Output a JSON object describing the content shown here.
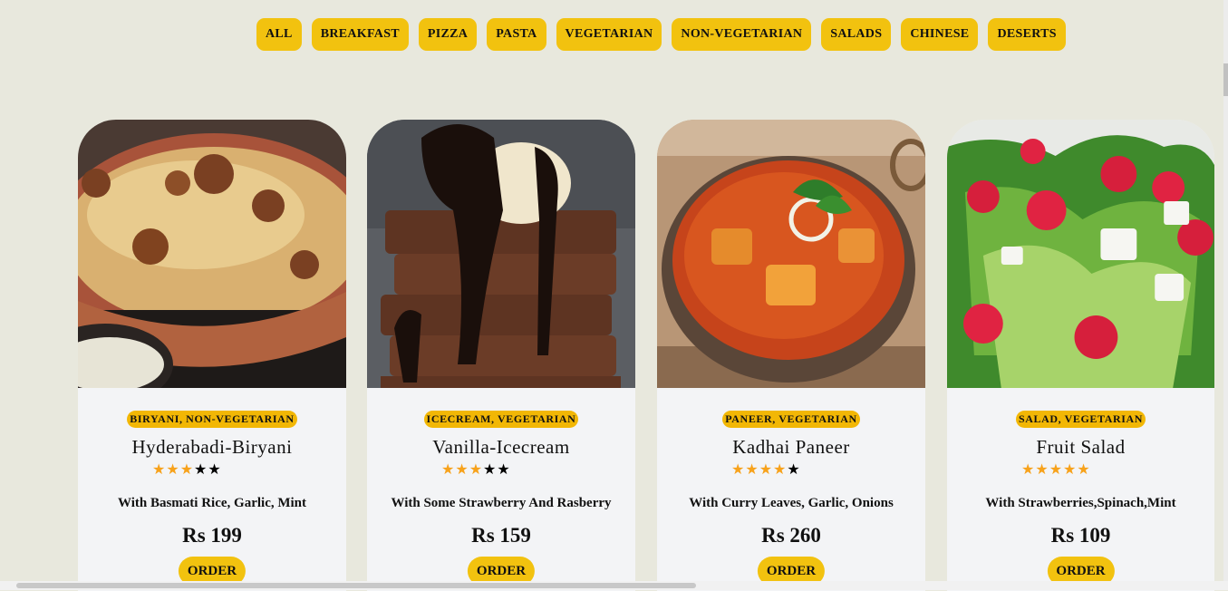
{
  "filters": [
    "ALL",
    "BREAKFAST",
    "PIZZA",
    "PASTA",
    "VEGETARIAN",
    "NON-VEGETARIAN",
    "SALADS",
    "CHINESE",
    "DESERTS"
  ],
  "cards": [
    {
      "tags": "BIRYANI, NON-VEGETARIAN",
      "name": "Hyderabadi-Biryani",
      "rating": 3,
      "max_rating": 5,
      "desc": "With Basmati Rice, Garlic, Mint",
      "price": "Rs 199",
      "order_label": "ORDER",
      "image": "biryani-image"
    },
    {
      "tags": "ICECREAM, VEGETARIAN",
      "name": "Vanilla-Icecream",
      "rating": 3,
      "max_rating": 5,
      "desc": "With Some Strawberry And Rasberry",
      "price": "Rs 159",
      "order_label": "ORDER",
      "image": "brownie-icecream-image"
    },
    {
      "tags": "PANEER, VEGETARIAN",
      "name": "Kadhai Paneer",
      "rating": 4,
      "max_rating": 5,
      "desc": "With Curry Leaves, Garlic, Onions",
      "price": "Rs 260",
      "order_label": "ORDER",
      "image": "kadhai-paneer-image"
    },
    {
      "tags": "SALAD, VEGETARIAN",
      "name": "Fruit Salad",
      "rating": 5,
      "max_rating": 5,
      "desc": "With Strawberries,Spinach,Mint",
      "price": "Rs 109",
      "order_label": "ORDER",
      "image": "fruit-salad-image"
    }
  ],
  "colors": {
    "accent": "#f2c20f",
    "tag": "#f2b705",
    "star": "#f7a21b",
    "background": "#e8e8dd",
    "card": "#f3f4f6"
  }
}
